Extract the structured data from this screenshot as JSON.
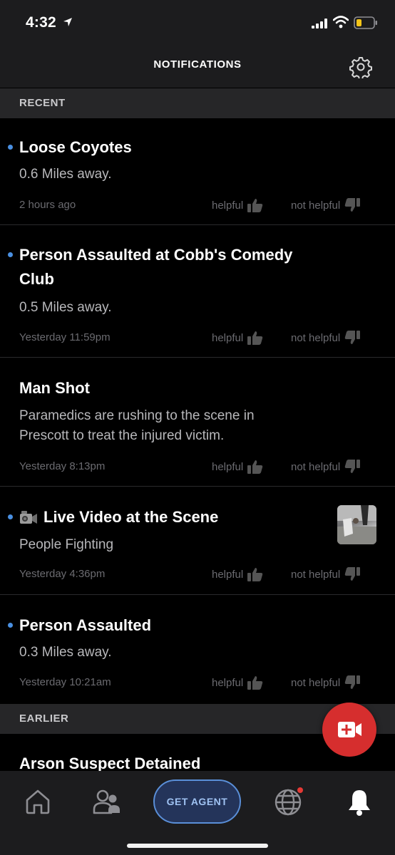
{
  "status_bar": {
    "time": "4:32"
  },
  "header": {
    "title": "NOTIFICATIONS"
  },
  "sections": {
    "recent": "RECENT",
    "earlier": "EARLIER"
  },
  "feedback": {
    "helpful": "helpful",
    "not_helpful": "not helpful"
  },
  "notifications": [
    {
      "title": "Loose Coyotes",
      "subtitle": "0.6 Miles away.",
      "time": "2 hours ago",
      "unread": true
    },
    {
      "title": "Person Assaulted at Cobb's Comedy Club",
      "subtitle": "0.5 Miles away.",
      "time": "Yesterday 11:59pm",
      "unread": true
    },
    {
      "title": "Man Shot",
      "subtitle": "Paramedics are rushing to the scene in Prescott to treat the injured victim.",
      "time": "Yesterday 8:13pm",
      "unread": false
    },
    {
      "title": "Live Video at the Scene",
      "subtitle": "People Fighting",
      "time": "Yesterday 4:36pm",
      "unread": true,
      "icon": "video-camera-icon",
      "has_thumbnail": true
    },
    {
      "title": "Person Assaulted",
      "subtitle": "0.3 Miles away.",
      "time": "Yesterday 10:21am",
      "unread": true
    }
  ],
  "earlier_notifications": [
    {
      "title": "Arson Suspect Detained"
    }
  ],
  "tab_bar": {
    "get_agent": "GET AGENT",
    "icons": [
      "home-icon",
      "people-icon",
      "globe-icon",
      "bell-icon"
    ]
  },
  "colors": {
    "accent": "#4a90e2",
    "fab": "#d62e2e",
    "badge": "#e53935"
  }
}
